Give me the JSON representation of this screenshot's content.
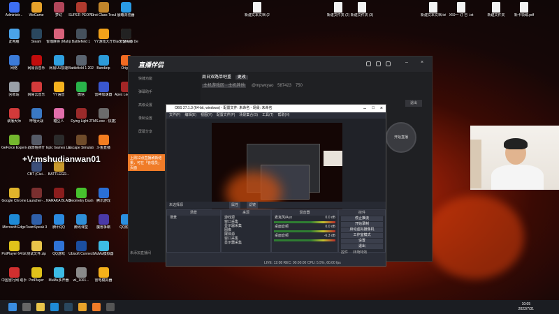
{
  "colors": {
    "accent": "#f07c28",
    "obs_bg": "#2b2e38",
    "live_bg": "#1f2023",
    "fire": "#e85a10"
  },
  "watermark": "+V:mshudianwan01",
  "desktop_icons": [
    {
      "label": "Administr...",
      "color": "#3d6ef2",
      "col": 0,
      "row": 0
    },
    {
      "label": "此电脑",
      "color": "#4aa3e8",
      "col": 0,
      "row": 1
    },
    {
      "label": "网络",
      "color": "#3b7bd8",
      "col": 0,
      "row": 2
    },
    {
      "label": "回收站",
      "color": "#9aa0a8",
      "col": 0,
      "row": 3
    },
    {
      "label": "录播大师",
      "color": "#d23a3a",
      "col": 0,
      "row": 4
    },
    {
      "label": "GeForce Experience",
      "color": "#74b72e",
      "col": 0,
      "row": 5
    },
    {
      "label": "Google Chrome",
      "color": "#e0b42b",
      "col": 0,
      "row": 7
    },
    {
      "label": "Microsoft Edge",
      "color": "#1e8ad6",
      "col": 0,
      "row": 8
    },
    {
      "label": "PotPlayer 64 bit",
      "color": "#e0c21a",
      "col": 0,
      "row": 9
    },
    {
      "label": "中国雷行网 助手",
      "color": "#d12f2f",
      "col": 0,
      "row": 10
    },
    {
      "label": "WeGame",
      "color": "#e7a22a",
      "col": 1,
      "row": 0
    },
    {
      "label": "Steam",
      "color": "#2a475e",
      "col": 1,
      "row": 1
    },
    {
      "label": "网易云音乐",
      "color": "#c20c0c",
      "col": 1,
      "row": 2
    },
    {
      "label": "网易云音乐",
      "color": "#d43b3b",
      "col": 1,
      "row": 3
    },
    {
      "label": "哔哩大战",
      "color": "#3a78c4",
      "col": 1,
      "row": 4
    },
    {
      "label": "战双帕弥什",
      "color": "#555a66",
      "col": 1,
      "row": 5
    },
    {
      "label": "CBT (Ciui...",
      "color": "#3c4f7a",
      "col": 1,
      "row": 6
    },
    {
      "label": "Launcher-...",
      "color": "#7a2f2f",
      "col": 1,
      "row": 7
    },
    {
      "label": "TeamSpeak 3",
      "color": "#2f5fa8",
      "col": 1,
      "row": 8
    },
    {
      "label": "测试文件.zip",
      "color": "#e8c44a",
      "col": 1,
      "row": 9
    },
    {
      "label": "PotPlayer",
      "color": "#e0c21a",
      "col": 1,
      "row": 10
    },
    {
      "label": "梦幻",
      "color": "#b2465a",
      "col": 2,
      "row": 0
    },
    {
      "label": "雀魂麻将 (Mahjong...",
      "color": "#d9627b",
      "col": 2,
      "row": 1
    },
    {
      "label": "网易UU加速",
      "color": "#2fa0e0",
      "col": 2,
      "row": 2
    },
    {
      "label": "YY语音",
      "color": "#f6b21e",
      "col": 2,
      "row": 3
    },
    {
      "label": "糖豆人",
      "color": "#e26eab",
      "col": 2,
      "row": 4
    },
    {
      "label": "Epic Games Launcher",
      "color": "#2b2b2b",
      "col": 2,
      "row": 5
    },
    {
      "label": "BATTLEGR...",
      "color": "#c99a2e",
      "col": 2,
      "row": 6
    },
    {
      "label": "NARAKA BLADEPOI...",
      "color": "#8b1d1d",
      "col": 2,
      "row": 7
    },
    {
      "label": "腾讯QQ",
      "color": "#2b8ae0",
      "col": 2,
      "row": 8
    },
    {
      "label": "QQ游戏",
      "color": "#2f73d6",
      "col": 2,
      "row": 9
    },
    {
      "label": "MuMu多开器",
      "color": "#3dbbe5",
      "col": 2,
      "row": 10
    },
    {
      "label": "SUPER PEOPLE CBT",
      "color": "#b03a2e",
      "col": 3,
      "row": 0
    },
    {
      "label": "Battlefield 1",
      "color": "#45505c",
      "col": 3,
      "row": 1
    },
    {
      "label": "Battlefield 1 2021.exe",
      "color": "#5a6470",
      "col": 3,
      "row": 2
    },
    {
      "label": "微信",
      "color": "#29b34a",
      "col": 3,
      "row": 3
    },
    {
      "label": "Dying Light 2",
      "color": "#9b2a2a",
      "col": 3,
      "row": 4
    },
    {
      "label": "Escape Simulator",
      "color": "#6f4b2a",
      "col": 3,
      "row": 5
    },
    {
      "label": "Geometry Dash",
      "color": "#47c22e",
      "col": 3,
      "row": 7
    },
    {
      "label": "腾讯课堂",
      "color": "#2e8fd8",
      "col": 3,
      "row": 8
    },
    {
      "label": "Ubisoft Connect",
      "color": "#1b4e9f",
      "col": 3,
      "row": 9
    },
    {
      "label": "wl_1001...",
      "color": "#8a8a8a",
      "col": 3,
      "row": 10
    },
    {
      "label": "First Class Trouble",
      "color": "#c2862b",
      "col": 4,
      "row": 0
    },
    {
      "label": "YY游戏大厅",
      "color": "#f2a21a",
      "col": 4,
      "row": 1
    },
    {
      "label": "Bandizip",
      "color": "#2c9ad8",
      "col": 4,
      "row": 2
    },
    {
      "label": "雷神加速器",
      "color": "#3a57d0",
      "col": 4,
      "row": 3
    },
    {
      "label": "TMS.exe - 快捷方式",
      "color": "#6b6b6b",
      "col": 4,
      "row": 4
    },
    {
      "label": "斗鱼直播",
      "color": "#f47d20",
      "col": 4,
      "row": 5
    },
    {
      "label": "腾讯游戏",
      "color": "#2a6fd6",
      "col": 4,
      "row": 7
    },
    {
      "label": "魔兽争霸",
      "color": "#4a3aa8",
      "col": 4,
      "row": 8
    },
    {
      "label": "MuMu模拟器",
      "color": "#3dbbe5",
      "col": 4,
      "row": 9
    },
    {
      "label": "雷电模拟器",
      "color": "#f5b01a",
      "col": 4,
      "row": 10
    },
    {
      "label": "晨曦浏览器",
      "color": "#2a9be4",
      "col": 5,
      "row": 0
    },
    {
      "label": "守望先锋",
      "color": "#e8862a",
      "col": 5,
      "row": 1
    },
    {
      "label": "Origin",
      "color": "#f26b22",
      "col": 5,
      "row": 2
    },
    {
      "label": "Apex Legends",
      "color": "#a32626",
      "col": 5,
      "row": 3
    },
    {
      "label": "Black Sheep Demo",
      "color": "#222",
      "col": 5,
      "row": 1
    },
    {
      "label": "QQ影音",
      "color": "#2a8fe0",
      "col": 5,
      "row": 8
    }
  ],
  "top_files": [
    {
      "label": "新建文本文档 (2).txt"
    },
    {
      "label": "新建文件夹 (2)"
    },
    {
      "label": "新建文件夹 (3)"
    },
    {
      "label": "新建文本文档.txt"
    },
    {
      "label": "X59一 订 已 .txt"
    },
    {
      "label": "新建文件夹"
    },
    {
      "label": "新卡领域.pdf"
    }
  ],
  "live_app": {
    "logo": "直播伴侣",
    "room_title": "周日双路单吧重",
    "room_tag": "更改",
    "room_sub": "主机游戏区 · 主机其他",
    "user": "@mpwxyao",
    "uid": "587423",
    "likes": "750",
    "side_items": [
      "快捷功能",
      "弹幕助手",
      "高级设置",
      "录制设置",
      "屏幕分享"
    ],
    "start_button": "开始直播",
    "exit_button": "退出",
    "orange_banner": "上周12点直播刷新结果，可在「管理员」页面",
    "scene_bottom": "未添加直播间 "
  },
  "obs": {
    "window_title": "OBS 27.1.3 (64-bit, windows) - 配置文件: 未命名 - 场景: 未命名",
    "menu": [
      "文件(F)",
      "编辑(E)",
      "视图(V)",
      "配置文件(P)",
      "场景集合(S)",
      "工具(T)",
      "帮助(H)"
    ],
    "no_source": "未选择源",
    "props": "属性",
    "filters": "滤镜",
    "docks": {
      "scenes": {
        "title": "场景",
        "items": [
          "场景"
        ]
      },
      "sources": {
        "title": "来源",
        "items": [
          "游戏源",
          "窗口采集",
          "显示器采集",
          "图像",
          "媒体源",
          "窗口采集",
          "显示器采集"
        ]
      },
      "mixer": {
        "title": "混音器",
        "channels": [
          {
            "name": "麦克风/Aux",
            "db": "0.0 dB"
          },
          {
            "name": "桌面音频",
            "db": "0.0 dB"
          },
          {
            "name": "桌面音频",
            "db": "-6.3 dB"
          }
        ]
      },
      "controls": {
        "title": "控件",
        "buttons": [
          "停止推流",
          "开始录制",
          "启动虚拟摄像机",
          "工作室模式",
          "设置",
          "退出"
        ]
      }
    },
    "status": "LIVE: 12:08    REC: 00:00:00    CPU: 5.5%, 60.00 fps",
    "transition_tab": "转场特效",
    "controls_tab": "控件"
  },
  "taskbar": {
    "time": "10:05",
    "date": "2022/7/31",
    "apps": [
      {
        "name": "windows",
        "color": "#3a8de0"
      },
      {
        "name": "search",
        "color": "#666"
      },
      {
        "name": "file-explorer",
        "color": "#e8c44a"
      },
      {
        "name": "edge",
        "color": "#1e8ad6"
      },
      {
        "name": "steam",
        "color": "#2a475e"
      },
      {
        "name": "wegame",
        "color": "#e7a22a"
      },
      {
        "name": "live-app",
        "color": "#f07c28"
      },
      {
        "name": "obs",
        "color": "#555"
      }
    ]
  }
}
